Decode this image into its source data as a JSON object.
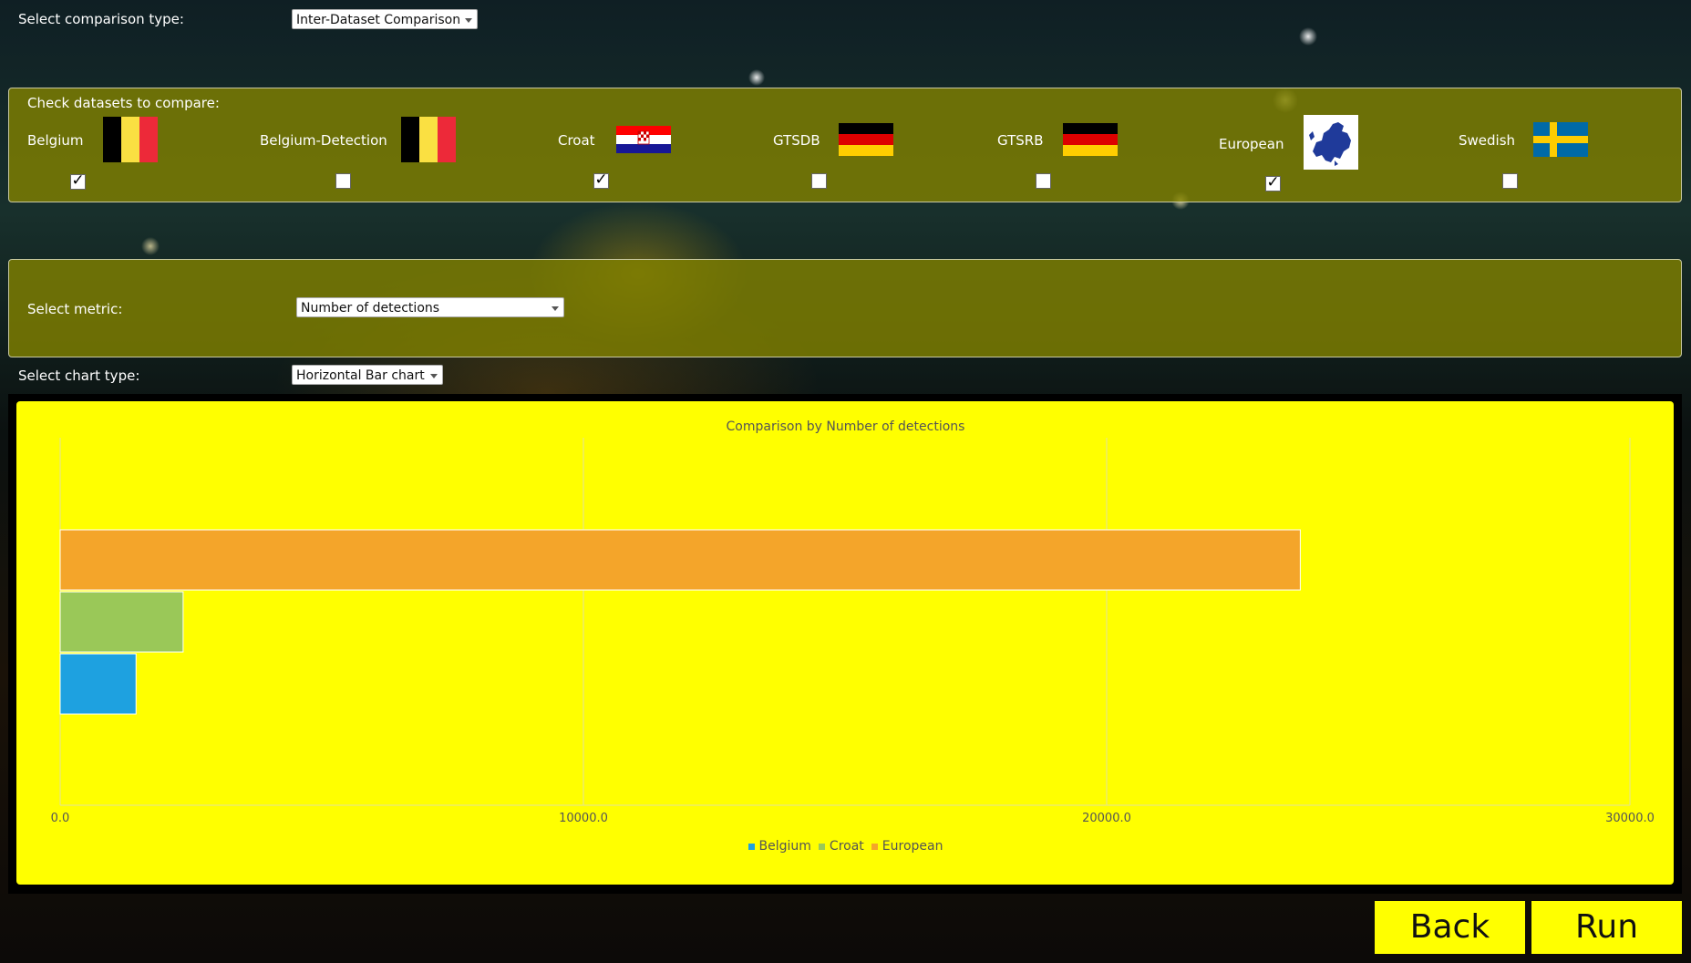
{
  "comparison": {
    "label": "Select comparison type:",
    "selected": "Inter-Dataset Comparison"
  },
  "datasets": {
    "heading": "Check datasets to compare:",
    "items": [
      {
        "label": "Belgium",
        "checked": true,
        "flag": "belgium-flag"
      },
      {
        "label": "Belgium-Detection",
        "checked": false,
        "flag": "belgium-flag"
      },
      {
        "label": "Croat",
        "checked": true,
        "flag": "croatia-flag"
      },
      {
        "label": "GTSDB",
        "checked": false,
        "flag": "germany-flag"
      },
      {
        "label": "GTSRB",
        "checked": false,
        "flag": "germany-flag"
      },
      {
        "label": "European",
        "checked": true,
        "flag": "europe-map"
      },
      {
        "label": "Swedish",
        "checked": false,
        "flag": "sweden-flag"
      }
    ]
  },
  "metric": {
    "label": "Select metric:",
    "selected": "Number of detections"
  },
  "chart_type": {
    "label": "Select chart type:",
    "selected": "Horizontal Bar chart"
  },
  "chart_data": {
    "type": "bar",
    "orientation": "horizontal",
    "title": "Comparison by Number of detections",
    "xlim": [
      0,
      30000
    ],
    "xticks": [
      "0.0",
      "10000.0",
      "20000.0",
      "30000.0"
    ],
    "grid": true,
    "legend_position": "bottom",
    "series": [
      {
        "name": "Belgium",
        "value": 1450,
        "color": "#1ea1e0"
      },
      {
        "name": "Croat",
        "value": 2350,
        "color": "#9ac858"
      },
      {
        "name": "European",
        "value": 23700,
        "color": "#f4a52a"
      }
    ]
  },
  "buttons": {
    "back": "Back",
    "run": "Run"
  },
  "colors": {
    "panel": "#808000",
    "chart_background": "#ffff00",
    "button": "#ffff00"
  }
}
